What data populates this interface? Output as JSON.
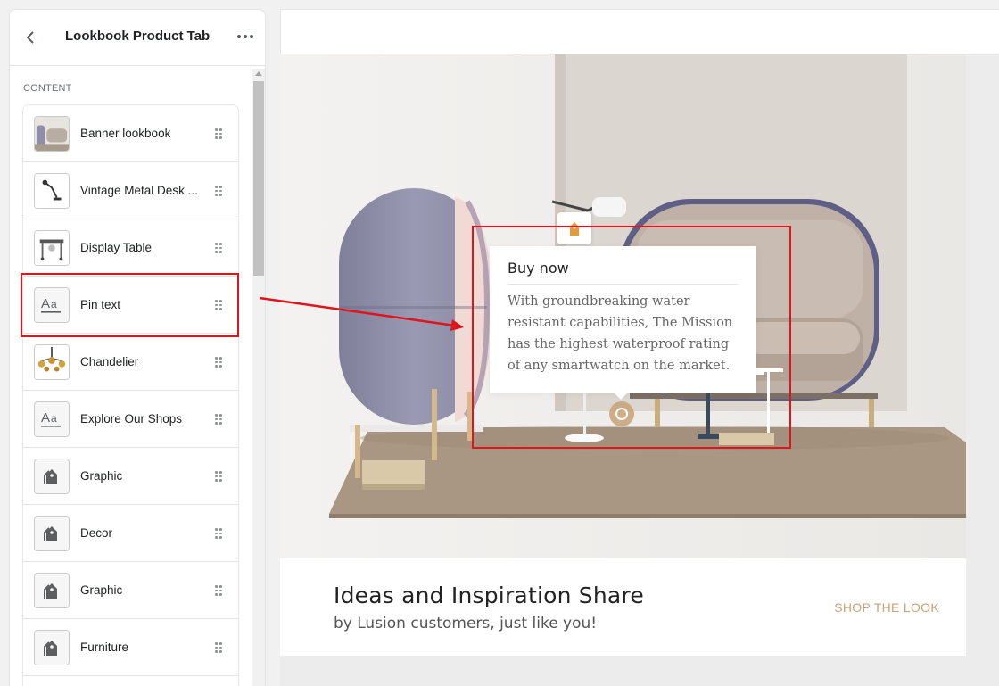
{
  "sidebar": {
    "title": "Lookbook Product Tab",
    "section_label": "CONTENT",
    "items": [
      {
        "label": "Banner lookbook",
        "thumb": "sofa-photo"
      },
      {
        "label": "Vintage Metal Desk ...",
        "thumb": "desk-lamp-photo"
      },
      {
        "label": "Display Table",
        "thumb": "table-photo"
      },
      {
        "label": "Pin text",
        "thumb": "text-icon"
      },
      {
        "label": "Chandelier",
        "thumb": "chandelier-photo"
      },
      {
        "label": "Explore Our Shops",
        "thumb": "text-icon"
      },
      {
        "label": "Graphic",
        "thumb": "tag-icon"
      },
      {
        "label": "Decor",
        "thumb": "tag-icon"
      },
      {
        "label": "Graphic",
        "thumb": "tag-icon"
      },
      {
        "label": "Furniture",
        "thumb": "tag-icon"
      }
    ]
  },
  "preview": {
    "popup": {
      "title": "Buy now",
      "text": "With groundbreaking water resistant capabilities, The Mission has the highest waterproof rating of any smartwatch on the market."
    },
    "caption": {
      "title": "Ideas and Inspiration Share",
      "subtitle": "by Lusion customers, just like you!",
      "button": "SHOP THE LOOK"
    }
  },
  "colors": {
    "accent": "#c8a276",
    "highlight": "#e0141b",
    "pod_purple": "#8f8ea8",
    "sofa_beige": "#c9bcb2"
  }
}
